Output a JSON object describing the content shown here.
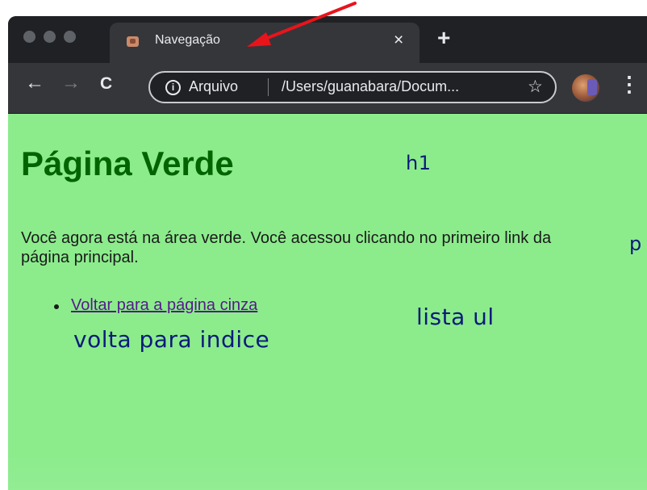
{
  "browser": {
    "tab": {
      "title": "Navegação",
      "close_glyph": "×"
    },
    "new_tab_glyph": "+",
    "nav": {
      "back_glyph": "←",
      "forward_glyph": "→",
      "reload_glyph": "C"
    },
    "omnibox": {
      "info_glyph": "i",
      "scheme_label": "Arquivo",
      "url": "/Users/guanabara/Docum...",
      "star_glyph": "☆"
    },
    "menu_glyph": "⋮"
  },
  "page": {
    "background_color": "#8cec8c",
    "heading": "Página Verde",
    "paragraph": "Você agora está na área verde. Você acessou clicando no primeiro link da página principal.",
    "list": [
      {
        "link_text": "Voltar para a página cinza"
      }
    ]
  },
  "annotations": {
    "h1_note": "h1",
    "p_note": "p",
    "list_note": "lista ul",
    "link_note": "volta para indice",
    "arrow_color": "#e8141c"
  }
}
